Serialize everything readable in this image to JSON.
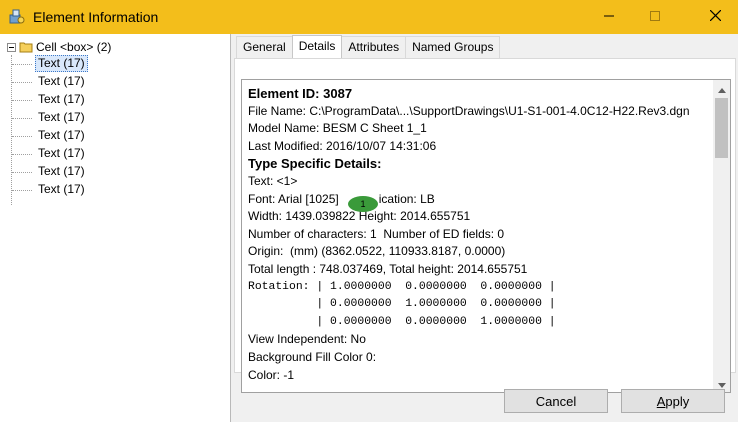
{
  "window": {
    "title": "Element Information"
  },
  "tree": {
    "root_label": "Cell <box> (2)",
    "items": [
      {
        "label": "Text (17)",
        "selected": true
      },
      {
        "label": "Text (17)"
      },
      {
        "label": "Text (17)"
      },
      {
        "label": "Text (17)"
      },
      {
        "label": "Text (17)"
      },
      {
        "label": "Text (17)"
      },
      {
        "label": "Text (17)"
      },
      {
        "label": "Text (17)"
      }
    ]
  },
  "tabs": [
    {
      "label": "General"
    },
    {
      "label": "Details",
      "active": true
    },
    {
      "label": "Attributes"
    },
    {
      "label": "Named Groups"
    }
  ],
  "details": {
    "lines": [
      {
        "text": "Element ID: 3087",
        "style": "bold"
      },
      {
        "text": "File Name: C:\\ProgramData\\...\\SupportDrawings\\U1-S1-001-4.0C12-H22.Rev3.dgn"
      },
      {
        "text": "Model Name: BESM C Sheet 1_1"
      },
      {
        "text": "Last Modified: 2016/10/07 14:31:06"
      },
      {
        "text": "Type Specific Details:",
        "style": "bold"
      },
      {
        "text": "Text: <1>"
      },
      {
        "text": "Font: Arial [1025]            ication: LB"
      },
      {
        "text": "Width: 1439.039822 Height: 2014.655751"
      },
      {
        "text": "Number of characters: 1  Number of ED fields: 0"
      },
      {
        "text": "Origin:  (mm) (8362.0522, 110933.8187, 0.0000)"
      },
      {
        "text": "Total length : 748.037469, Total height: 2014.655751"
      },
      {
        "text": "Rotation: | 1.0000000  0.0000000  0.0000000 |",
        "style": "mono"
      },
      {
        "text": "          | 0.0000000  1.0000000  0.0000000 |",
        "style": "mono"
      },
      {
        "text": "          | 0.0000000  0.0000000  1.0000000 |",
        "style": "mono"
      },
      {
        "text": "View Independent: No"
      },
      {
        "text": "Background Fill Color 0:"
      },
      {
        "text": "Color: -1"
      }
    ],
    "marker_label": "1",
    "marker_color": "#3a9a3a"
  },
  "buttons": {
    "cancel": "Cancel",
    "apply_first": "A",
    "apply_rest": "pply"
  },
  "colors": {
    "titlebar": "#f3be1b",
    "selection": "#d9e8fb"
  },
  "icons": {
    "app": "element-info-icon",
    "minimize": "minimize-icon",
    "maximize": "maximize-icon",
    "close": "close-icon",
    "folder": "cell-folder-icon"
  }
}
